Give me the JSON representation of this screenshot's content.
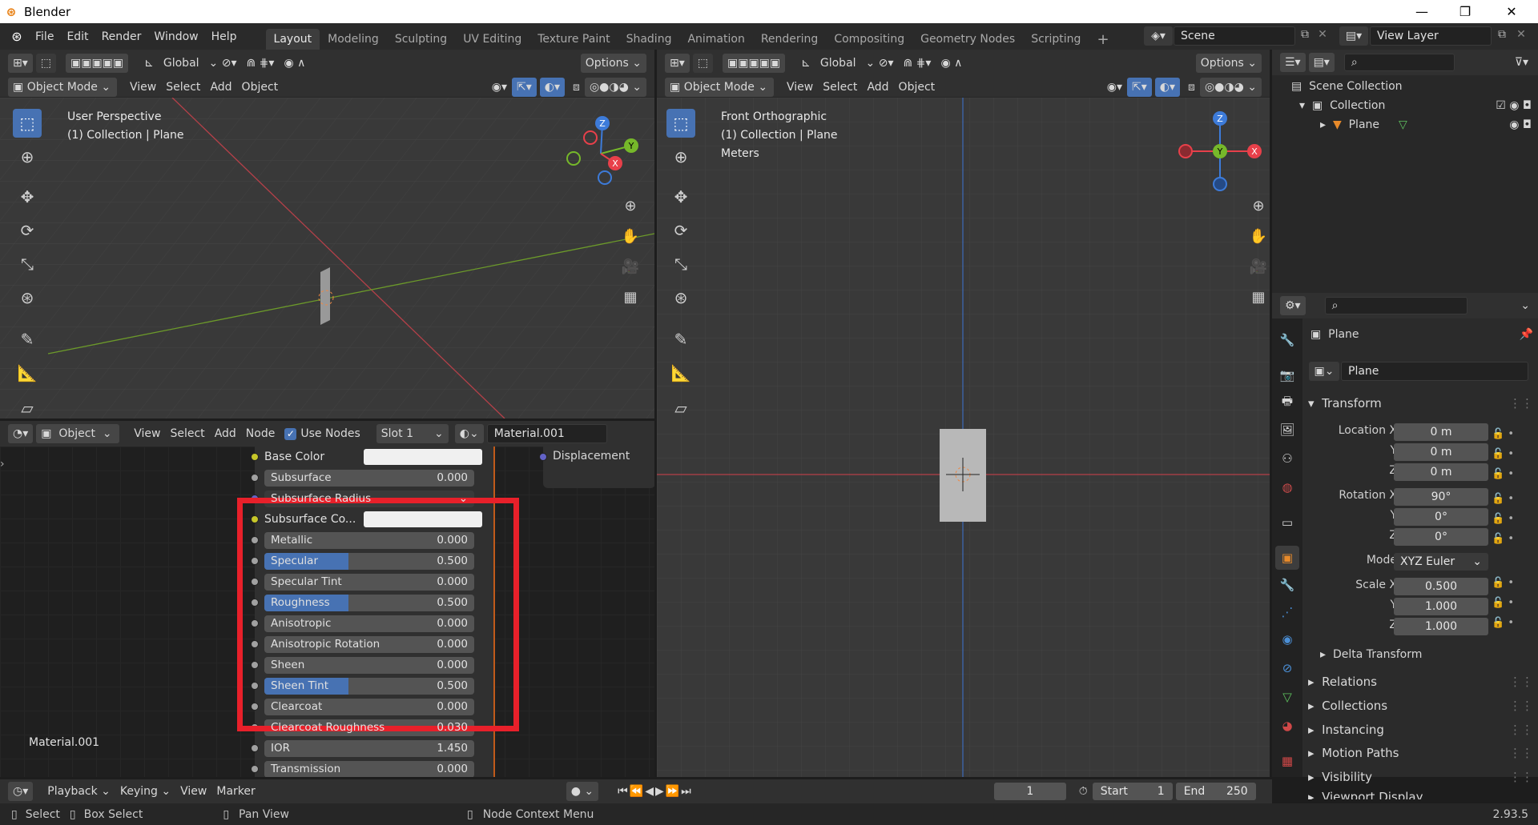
{
  "app": {
    "title": "Blender"
  },
  "window_controls": {
    "minimize": "—",
    "maximize": "❐",
    "close": "✕"
  },
  "menu": [
    "File",
    "Edit",
    "Render",
    "Window",
    "Help"
  ],
  "workspaces": [
    "Layout",
    "Modeling",
    "Sculpting",
    "UV Editing",
    "Texture Paint",
    "Shading",
    "Animation",
    "Rendering",
    "Compositing",
    "Geometry Nodes",
    "Scripting"
  ],
  "workspace_add": "+",
  "scene": {
    "label": "Scene"
  },
  "view_layer": {
    "label": "View Layer"
  },
  "viewport_left": {
    "orientation": "Global",
    "options": "Options",
    "mode": "Object Mode",
    "menus": [
      "View",
      "Select",
      "Add",
      "Object"
    ],
    "perspective": "User Perspective",
    "collection": "(1) Collection | Plane",
    "gizmo": {
      "z": "Z",
      "y": "Y",
      "x": "X"
    }
  },
  "viewport_right": {
    "orientation": "Global",
    "options": "Options",
    "mode": "Object Mode",
    "menus": [
      "View",
      "Select",
      "Add",
      "Object"
    ],
    "perspective": "Front Orthographic",
    "collection": "(1) Collection | Plane",
    "units": "Meters",
    "gizmo": {
      "z": "Z",
      "y": "Y",
      "x": "X"
    }
  },
  "node_editor": {
    "object_mode": "Object",
    "menus": [
      "View",
      "Select",
      "Add",
      "Node"
    ],
    "use_nodes": "Use Nodes",
    "slot": "Slot 1",
    "material": "Material.001",
    "material_label": "Material.001",
    "output_socket": "Displacement",
    "rows": [
      {
        "label": "Base Color",
        "type": "color",
        "socket": "yellow"
      },
      {
        "label": "Subsurface",
        "value": "0.000",
        "fill": 0
      },
      {
        "label": "Subsurface Radius",
        "type": "vector",
        "socket": "purple"
      },
      {
        "label": "Subsurface Co...",
        "type": "color",
        "socket": "yellow"
      },
      {
        "label": "Metallic",
        "value": "0.000",
        "fill": 0
      },
      {
        "label": "Specular",
        "value": "0.500",
        "fill": 0.4
      },
      {
        "label": "Specular Tint",
        "value": "0.000",
        "fill": 0
      },
      {
        "label": "Roughness",
        "value": "0.500",
        "fill": 0.4
      },
      {
        "label": "Anisotropic",
        "value": "0.000",
        "fill": 0
      },
      {
        "label": "Anisotropic Rotation",
        "value": "0.000",
        "fill": 0
      },
      {
        "label": "Sheen",
        "value": "0.000",
        "fill": 0
      },
      {
        "label": "Sheen Tint",
        "value": "0.500",
        "fill": 0.4
      },
      {
        "label": "Clearcoat",
        "value": "0.000",
        "fill": 0
      },
      {
        "label": "Clearcoat Roughness",
        "value": "0.030",
        "fill": 0
      },
      {
        "label": "IOR",
        "value": "1.450",
        "fill": 0
      },
      {
        "label": "Transmission",
        "value": "0.000",
        "fill": 0
      }
    ],
    "highlight_color": "#e8202a"
  },
  "outliner": {
    "scene_collection": "Scene Collection",
    "collection": "Collection",
    "plane": "Plane"
  },
  "properties": {
    "object_name": "Plane",
    "data_name": "Plane",
    "transform": "Transform",
    "location": {
      "label_x": "Location X",
      "label_y": "Y",
      "label_z": "Z",
      "x": "0 m",
      "y": "0 m",
      "z": "0 m"
    },
    "rotation": {
      "label_x": "Rotation X",
      "label_y": "Y",
      "label_z": "Z",
      "x": "90°",
      "y": "0°",
      "z": "0°"
    },
    "mode": {
      "label": "Mode",
      "value": "XYZ Euler"
    },
    "scale": {
      "label_x": "Scale X",
      "label_y": "Y",
      "label_z": "Z",
      "x": "0.500",
      "y": "1.000",
      "z": "1.000"
    },
    "sections": [
      "Delta Transform",
      "Relations",
      "Collections",
      "Instancing",
      "Motion Paths",
      "Visibility",
      "Viewport Display"
    ]
  },
  "timeline": {
    "menus": [
      "Playback",
      "Keying",
      "View",
      "Marker"
    ],
    "current_frame": "1",
    "start_label": "Start",
    "start": "1",
    "end_label": "End",
    "end": "250"
  },
  "statusbar": {
    "select": "Select",
    "box_select": "Box Select",
    "pan_view": "Pan View",
    "node_context": "Node Context Menu",
    "version": "2.93.5"
  },
  "colors": {
    "accent": "#4772b3",
    "x_axis": "#e8404a",
    "y_axis": "#76b82a",
    "z_axis": "#3d7bd9",
    "header": "#303030",
    "viewport": "#393939"
  }
}
